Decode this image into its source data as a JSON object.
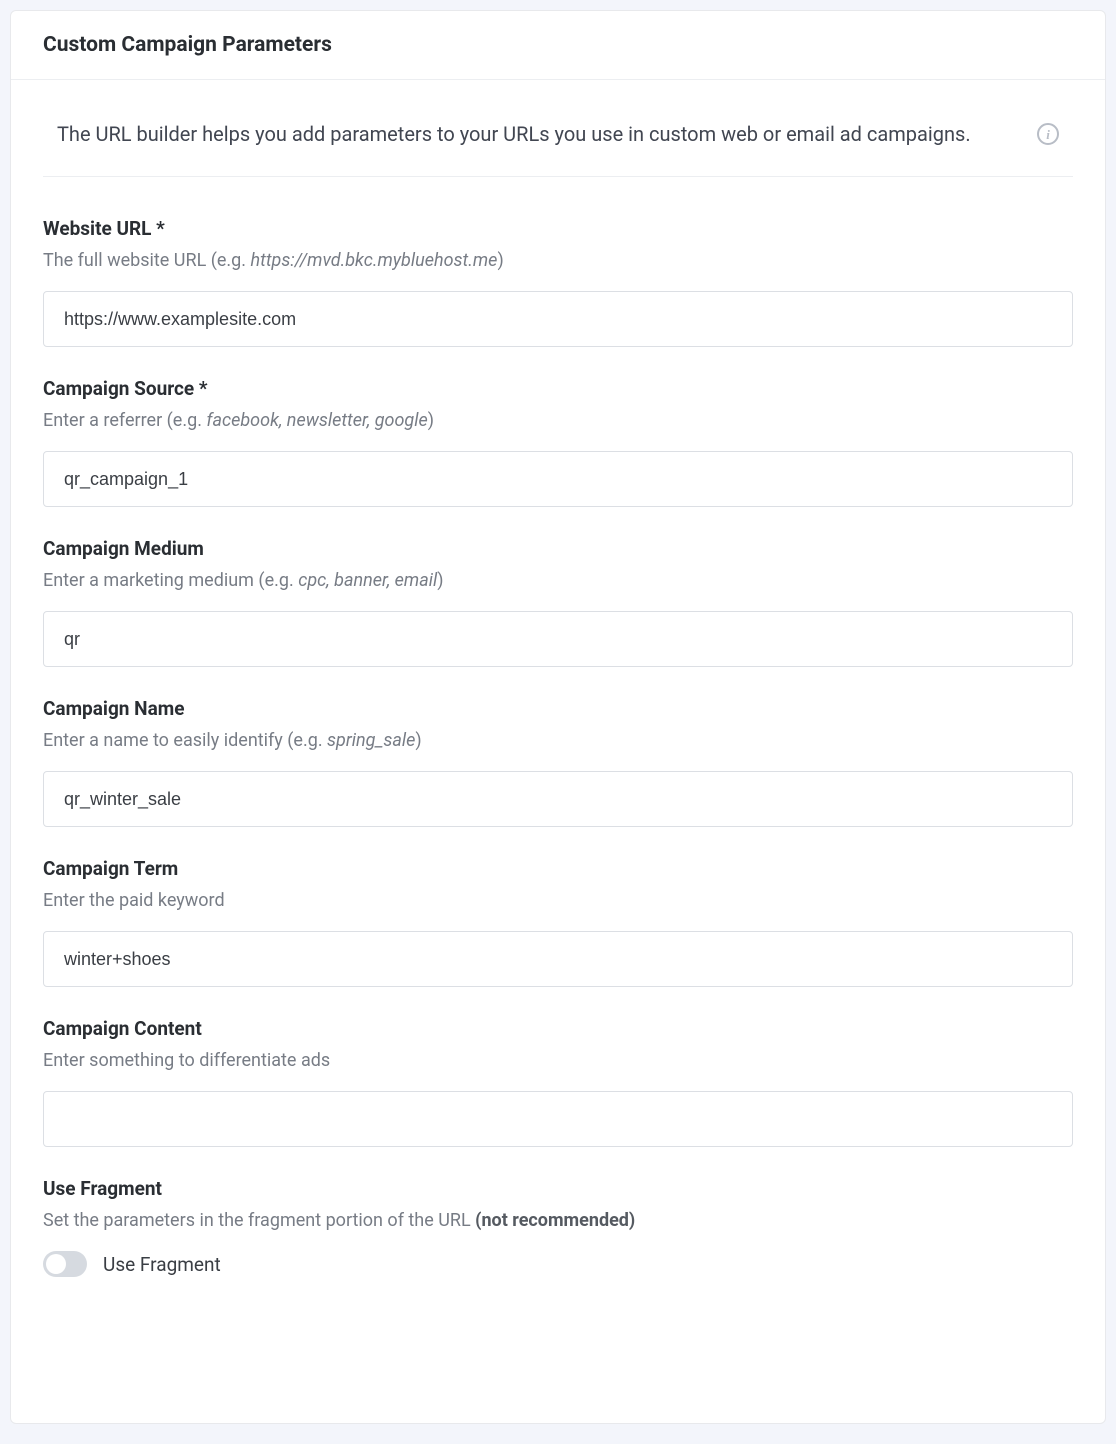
{
  "header": {
    "title": "Custom Campaign Parameters"
  },
  "intro": {
    "text": "The URL builder helps you add parameters to your URLs you use in custom web or email ad campaigns."
  },
  "fields": {
    "website_url": {
      "label": "Website URL *",
      "hint_prefix": "The full website URL (e.g. ",
      "hint_italic": "https://mvd.bkc.mybluehost.me",
      "hint_suffix": ")",
      "value": "https://www.examplesite.com"
    },
    "campaign_source": {
      "label": "Campaign Source *",
      "hint_prefix": "Enter a referrer (e.g. ",
      "hint_italic": "facebook, newsletter, google",
      "hint_suffix": ")",
      "value": "qr_campaign_1"
    },
    "campaign_medium": {
      "label": "Campaign Medium",
      "hint_prefix": "Enter a marketing medium (e.g. ",
      "hint_italic": "cpc, banner, email",
      "hint_suffix": ")",
      "value": "qr"
    },
    "campaign_name": {
      "label": "Campaign Name",
      "hint_prefix": "Enter a name to easily identify (e.g. ",
      "hint_italic": "spring_sale",
      "hint_suffix": ")",
      "value": "qr_winter_sale"
    },
    "campaign_term": {
      "label": "Campaign Term",
      "hint": "Enter the paid keyword",
      "value": "winter+shoes"
    },
    "campaign_content": {
      "label": "Campaign Content",
      "hint": "Enter something to differentiate ads",
      "value": ""
    },
    "use_fragment": {
      "label": "Use Fragment",
      "hint_prefix": "Set the parameters in the fragment portion of the URL ",
      "hint_bold": "(not recommended)",
      "toggle_label": "Use Fragment",
      "enabled": false
    }
  },
  "icons": {
    "info_glyph": "i"
  }
}
